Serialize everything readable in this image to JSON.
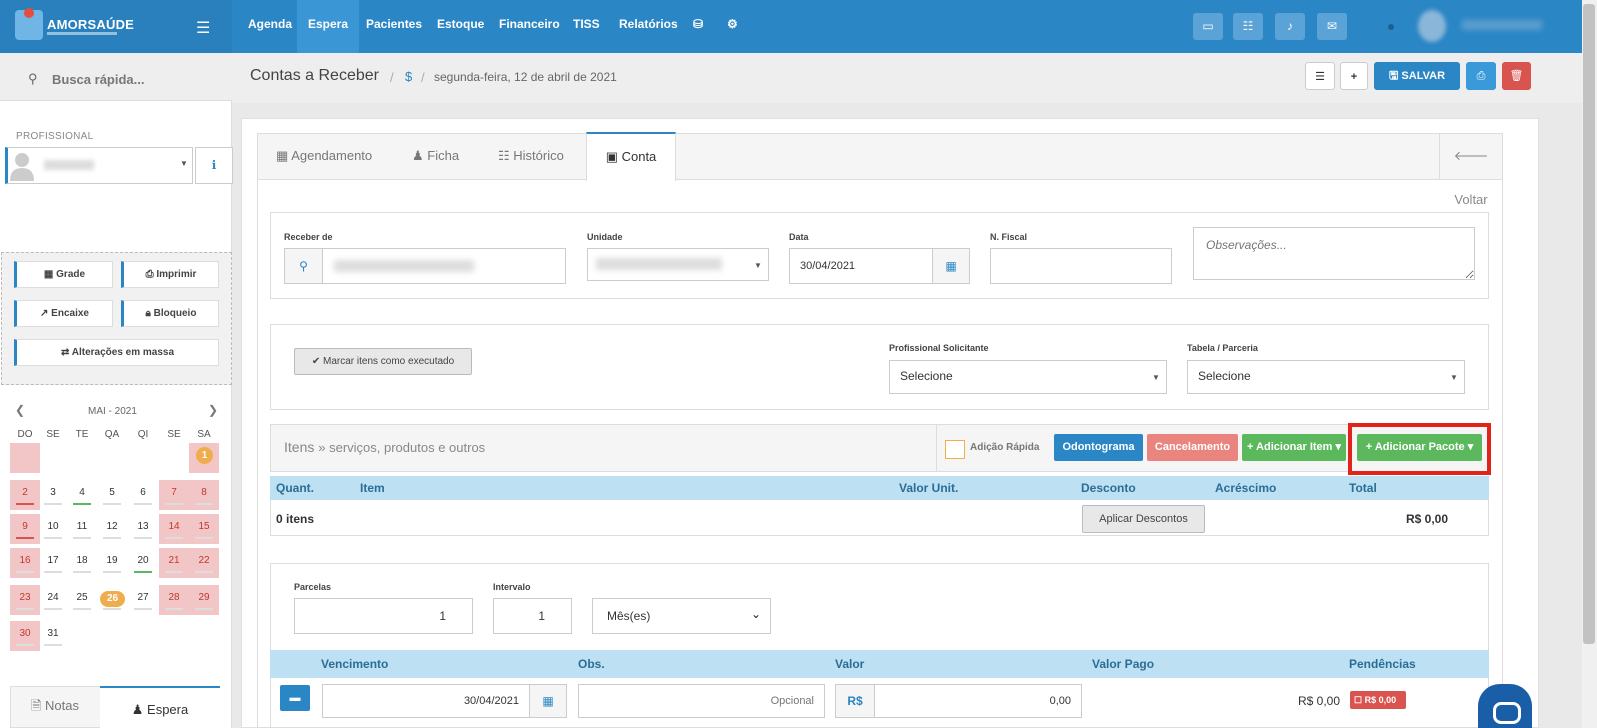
{
  "brand": {
    "name": "AMORSAÚDE"
  },
  "nav": {
    "items": [
      "Agenda",
      "Espera",
      "Pacientes",
      "Estoque",
      "Financeiro",
      "TISS",
      "Relatórios"
    ],
    "active": "Espera"
  },
  "sidebar": {
    "quick_search": "Busca rápida...",
    "professional_label": "PROFISSIONAL",
    "buttons": {
      "grade": "Grade",
      "imprimir": "Imprimir",
      "encaixe": "Encaixe",
      "bloqueio": "Bloqueio",
      "alteracoes": "Alterações em massa"
    },
    "calendar": {
      "title": "MAI - 2021",
      "weekdays": [
        "DO",
        "SE",
        "TE",
        "QA",
        "QI",
        "SE",
        "SA"
      ],
      "today": "26",
      "badge_day": "1",
      "badge_count": "1"
    },
    "tabs": {
      "notas": "Notas",
      "espera": "Espera"
    }
  },
  "header": {
    "title": "Contas a Receber",
    "crumb_icon": "$",
    "date": "segunda-feira, 12 de abril de 2021",
    "save_label": "SALVAR"
  },
  "tabs": {
    "agendamento": "Agendamento",
    "ficha": "Ficha",
    "historico": "Histórico",
    "conta": "Conta",
    "voltar": "Voltar"
  },
  "form": {
    "receber_de_label": "Receber de",
    "unidade_label": "Unidade",
    "data_label": "Data",
    "data_value": "30/04/2021",
    "nfiscal_label": "N. Fiscal",
    "observacoes_placeholder": "Observações..."
  },
  "exec": {
    "marcar_label": "Marcar itens como executado",
    "prof_solicitante_label": "Profissional Solicitante",
    "prof_solicitante_value": "Selecione",
    "tabela_label": "Tabela / Parceria",
    "tabela_value": "Selecione"
  },
  "items": {
    "title": "Itens",
    "subtitle": "» serviços, produtos e outros",
    "rapid_label": "Adição Rápida",
    "btn_odontograma": "Odontograma",
    "btn_cancelamento": "Cancelamento",
    "btn_adicionar_item": "Adicionar Item",
    "btn_adicionar_pacote": "Adicionar Pacote",
    "columns": [
      "Quant.",
      "Item",
      "Valor Unit.",
      "Desconto",
      "Acréscimo",
      "Total"
    ],
    "count": "0 itens",
    "btn_aplicar": "Aplicar Descontos",
    "total": "R$ 0,00"
  },
  "payment": {
    "parcelas_label": "Parcelas",
    "parcelas_value": "1",
    "intervalo_label": "Intervalo",
    "intervalo_value": "1",
    "periodo_value": "Mês(es)",
    "columns": [
      "Vencimento",
      "Obs.",
      "Valor",
      "Valor Pago",
      "Pendências"
    ],
    "vencimento": "30/04/2021",
    "obs_placeholder": "Opcional",
    "currency": "R$",
    "valor": "0,00",
    "valor_pago": "R$ 0,00",
    "pendencia": "R$ 0,00"
  },
  "colors": {
    "primary": "#2b86c5",
    "success": "#5cb85c",
    "danger": "#d9534f",
    "highlight": "#e2231a"
  }
}
